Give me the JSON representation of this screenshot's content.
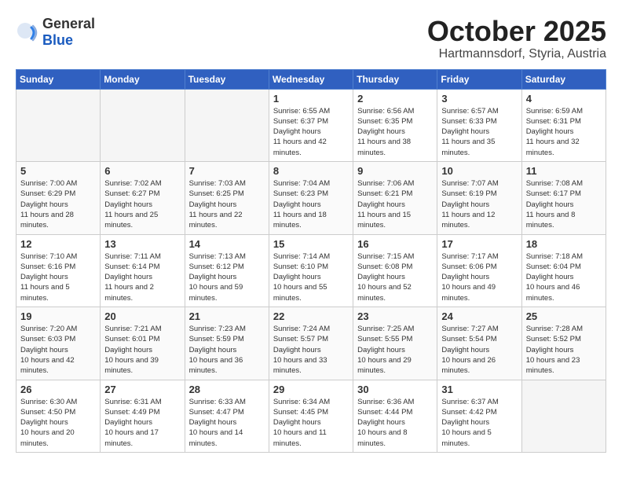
{
  "header": {
    "logo_general": "General",
    "logo_blue": "Blue",
    "month": "October 2025",
    "location": "Hartmannsdorf, Styria, Austria"
  },
  "days_of_week": [
    "Sunday",
    "Monday",
    "Tuesday",
    "Wednesday",
    "Thursday",
    "Friday",
    "Saturday"
  ],
  "weeks": [
    [
      {
        "num": "",
        "empty": true
      },
      {
        "num": "",
        "empty": true
      },
      {
        "num": "",
        "empty": true
      },
      {
        "num": "1",
        "sunrise": "6:55 AM",
        "sunset": "6:37 PM",
        "daylight": "11 hours and 42 minutes."
      },
      {
        "num": "2",
        "sunrise": "6:56 AM",
        "sunset": "6:35 PM",
        "daylight": "11 hours and 38 minutes."
      },
      {
        "num": "3",
        "sunrise": "6:57 AM",
        "sunset": "6:33 PM",
        "daylight": "11 hours and 35 minutes."
      },
      {
        "num": "4",
        "sunrise": "6:59 AM",
        "sunset": "6:31 PM",
        "daylight": "11 hours and 32 minutes."
      }
    ],
    [
      {
        "num": "5",
        "sunrise": "7:00 AM",
        "sunset": "6:29 PM",
        "daylight": "11 hours and 28 minutes."
      },
      {
        "num": "6",
        "sunrise": "7:02 AM",
        "sunset": "6:27 PM",
        "daylight": "11 hours and 25 minutes."
      },
      {
        "num": "7",
        "sunrise": "7:03 AM",
        "sunset": "6:25 PM",
        "daylight": "11 hours and 22 minutes."
      },
      {
        "num": "8",
        "sunrise": "7:04 AM",
        "sunset": "6:23 PM",
        "daylight": "11 hours and 18 minutes."
      },
      {
        "num": "9",
        "sunrise": "7:06 AM",
        "sunset": "6:21 PM",
        "daylight": "11 hours and 15 minutes."
      },
      {
        "num": "10",
        "sunrise": "7:07 AM",
        "sunset": "6:19 PM",
        "daylight": "11 hours and 12 minutes."
      },
      {
        "num": "11",
        "sunrise": "7:08 AM",
        "sunset": "6:17 PM",
        "daylight": "11 hours and 8 minutes."
      }
    ],
    [
      {
        "num": "12",
        "sunrise": "7:10 AM",
        "sunset": "6:16 PM",
        "daylight": "11 hours and 5 minutes."
      },
      {
        "num": "13",
        "sunrise": "7:11 AM",
        "sunset": "6:14 PM",
        "daylight": "11 hours and 2 minutes."
      },
      {
        "num": "14",
        "sunrise": "7:13 AM",
        "sunset": "6:12 PM",
        "daylight": "10 hours and 59 minutes."
      },
      {
        "num": "15",
        "sunrise": "7:14 AM",
        "sunset": "6:10 PM",
        "daylight": "10 hours and 55 minutes."
      },
      {
        "num": "16",
        "sunrise": "7:15 AM",
        "sunset": "6:08 PM",
        "daylight": "10 hours and 52 minutes."
      },
      {
        "num": "17",
        "sunrise": "7:17 AM",
        "sunset": "6:06 PM",
        "daylight": "10 hours and 49 minutes."
      },
      {
        "num": "18",
        "sunrise": "7:18 AM",
        "sunset": "6:04 PM",
        "daylight": "10 hours and 46 minutes."
      }
    ],
    [
      {
        "num": "19",
        "sunrise": "7:20 AM",
        "sunset": "6:03 PM",
        "daylight": "10 hours and 42 minutes."
      },
      {
        "num": "20",
        "sunrise": "7:21 AM",
        "sunset": "6:01 PM",
        "daylight": "10 hours and 39 minutes."
      },
      {
        "num": "21",
        "sunrise": "7:23 AM",
        "sunset": "5:59 PM",
        "daylight": "10 hours and 36 minutes."
      },
      {
        "num": "22",
        "sunrise": "7:24 AM",
        "sunset": "5:57 PM",
        "daylight": "10 hours and 33 minutes."
      },
      {
        "num": "23",
        "sunrise": "7:25 AM",
        "sunset": "5:55 PM",
        "daylight": "10 hours and 29 minutes."
      },
      {
        "num": "24",
        "sunrise": "7:27 AM",
        "sunset": "5:54 PM",
        "daylight": "10 hours and 26 minutes."
      },
      {
        "num": "25",
        "sunrise": "7:28 AM",
        "sunset": "5:52 PM",
        "daylight": "10 hours and 23 minutes."
      }
    ],
    [
      {
        "num": "26",
        "sunrise": "6:30 AM",
        "sunset": "4:50 PM",
        "daylight": "10 hours and 20 minutes."
      },
      {
        "num": "27",
        "sunrise": "6:31 AM",
        "sunset": "4:49 PM",
        "daylight": "10 hours and 17 minutes."
      },
      {
        "num": "28",
        "sunrise": "6:33 AM",
        "sunset": "4:47 PM",
        "daylight": "10 hours and 14 minutes."
      },
      {
        "num": "29",
        "sunrise": "6:34 AM",
        "sunset": "4:45 PM",
        "daylight": "10 hours and 11 minutes."
      },
      {
        "num": "30",
        "sunrise": "6:36 AM",
        "sunset": "4:44 PM",
        "daylight": "10 hours and 8 minutes."
      },
      {
        "num": "31",
        "sunrise": "6:37 AM",
        "sunset": "4:42 PM",
        "daylight": "10 hours and 5 minutes."
      },
      {
        "num": "",
        "empty": true
      }
    ]
  ],
  "labels": {
    "sunrise": "Sunrise:",
    "sunset": "Sunset:",
    "daylight": "Daylight hours"
  }
}
